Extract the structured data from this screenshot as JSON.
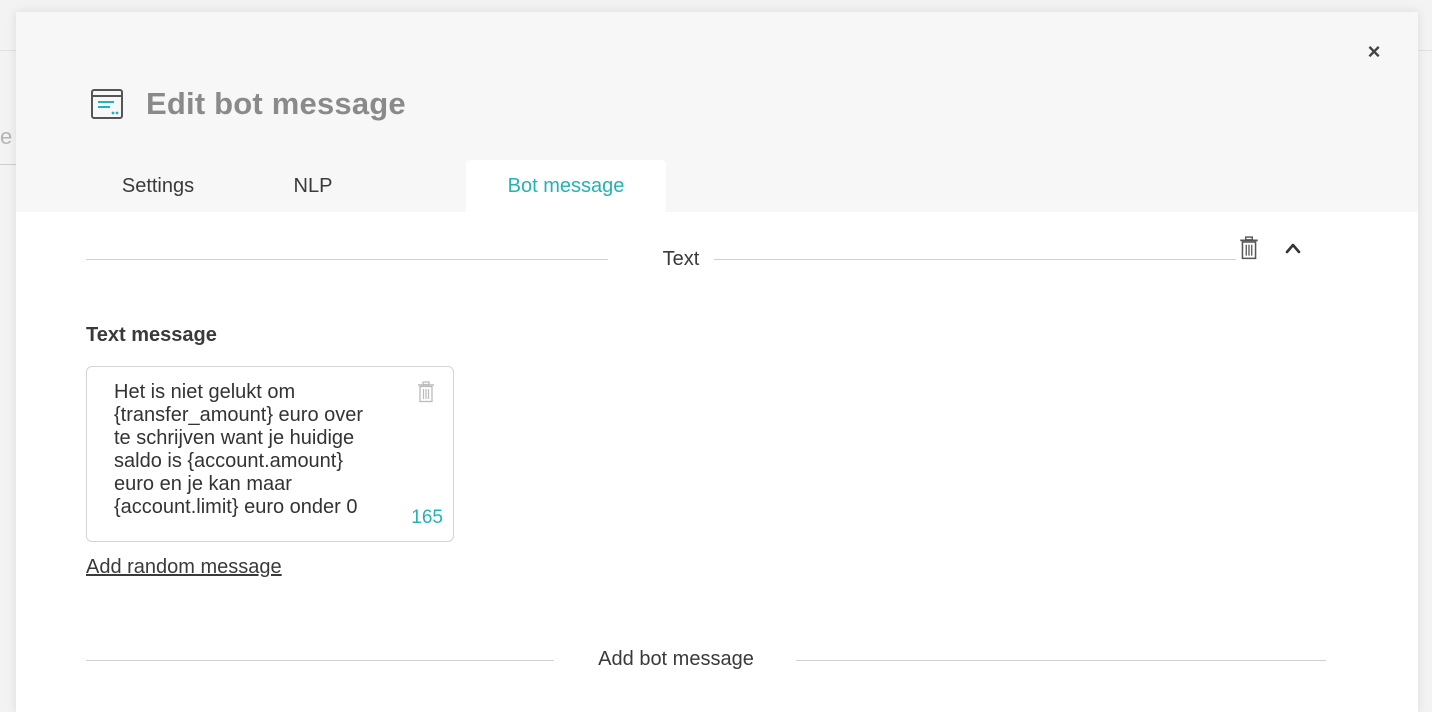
{
  "background": {
    "partial_letter": "e"
  },
  "modal": {
    "close_label": "×",
    "title": "Edit bot message",
    "header_icon": "message-window-icon"
  },
  "tabs": [
    {
      "label": "Settings",
      "active": false
    },
    {
      "label": "NLP",
      "active": false
    },
    {
      "label": "Bot message",
      "active": true
    }
  ],
  "section": {
    "title": "Text",
    "delete_icon": "trash-icon",
    "collapse_icon": "chevron-up-icon"
  },
  "text_message": {
    "label": "Text message",
    "value": "Het is niet gelukt om\n{transfer_amount} euro over\nte schrijven want je huidige\nsaldo is {account.amount}\neuro en je kan maar\n{account.limit} euro onder 0",
    "char_count": "165",
    "delete_icon": "trash-icon"
  },
  "add_random_label": "Add random message",
  "add_bot_message_label": "Add bot message",
  "colors": {
    "accent": "#22b3b3",
    "panel": "#ffffff",
    "modal_bg": "#f7f7f7"
  }
}
